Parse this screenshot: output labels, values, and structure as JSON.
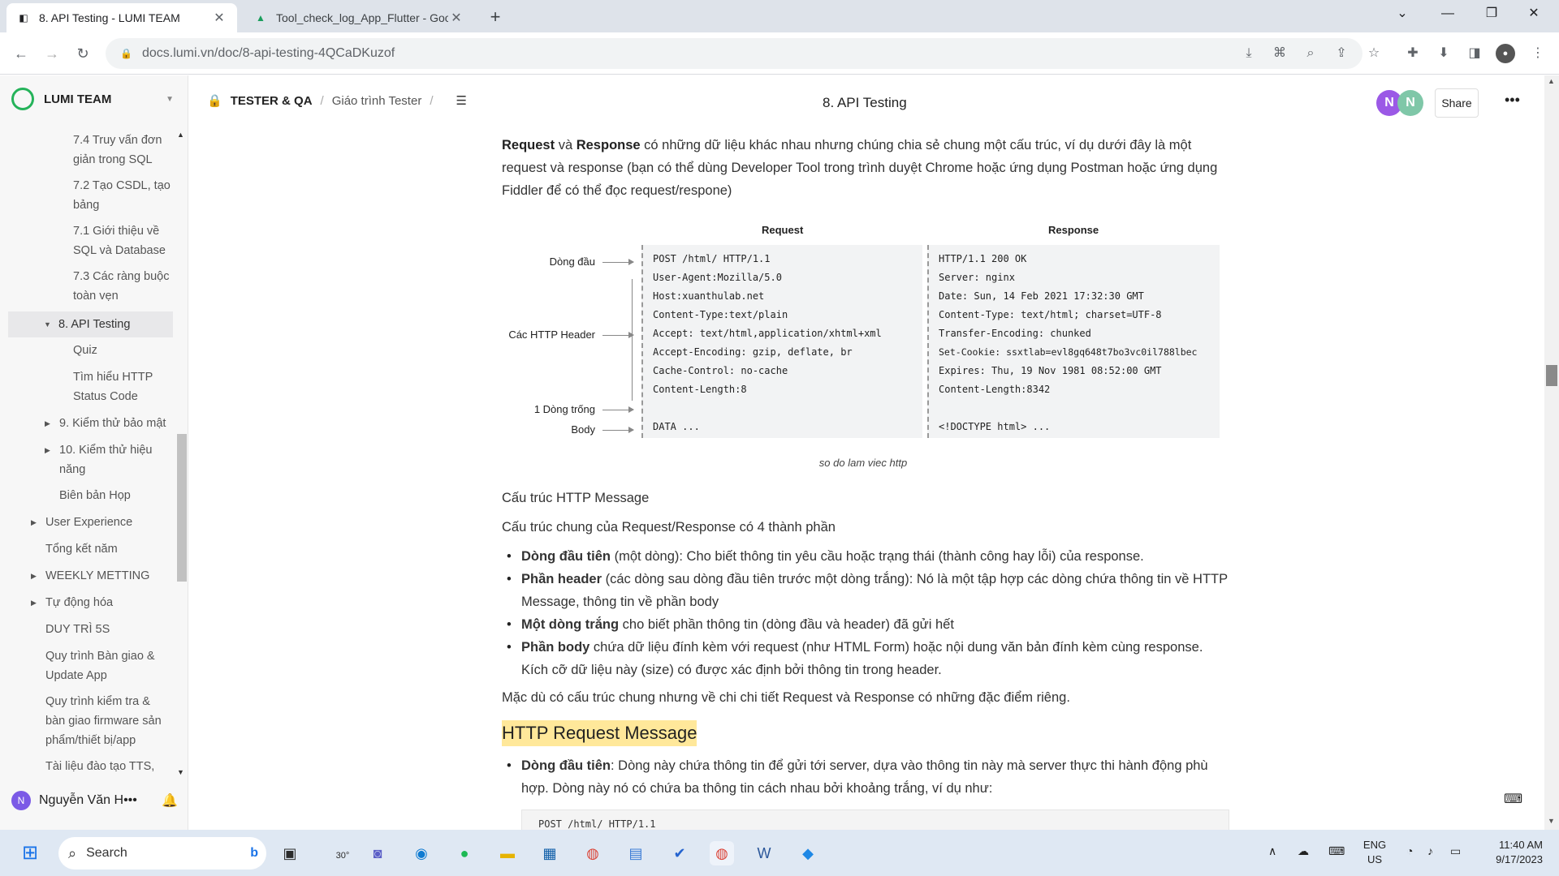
{
  "browser": {
    "tabs": [
      {
        "title": "8. API Testing - LUMI TEAM",
        "active": true
      },
      {
        "title": "Tool_check_log_App_Flutter - Goo",
        "active": false
      }
    ],
    "new_tab": "+",
    "url": "docs.lumi.vn/doc/8-api-testing-4QCaDKuzof"
  },
  "sidebar": {
    "team_name": "LUMI TEAM",
    "items": [
      {
        "label": "7.4 Truy vấn đơn",
        "label2": "giản trong SQL"
      },
      {
        "label": "7.2 Tạo CSDL, tạo",
        "label2": "bảng"
      },
      {
        "label": "7.1 Giới thiệu về",
        "label2": "SQL và Database"
      },
      {
        "label": "7.3 Các ràng buộc",
        "label2": "toàn vẹn"
      },
      {
        "label": "8. API Testing"
      },
      {
        "label": "Quiz"
      },
      {
        "label": "Tìm hiểu HTTP",
        "label2": "Status Code"
      },
      {
        "label": "9. Kiểm thử bảo mật"
      },
      {
        "label": "10. Kiểm thử hiệu",
        "label2": "năng"
      },
      {
        "label": "Biên bản Họp"
      },
      {
        "label": "User Experience"
      },
      {
        "label": "Tổng kết năm"
      },
      {
        "label": "WEEKLY METTING"
      },
      {
        "label": "Tự động hóa"
      },
      {
        "label": "DUY TRÌ 5S"
      },
      {
        "label": "Quy trình Bàn giao &",
        "label2": "Update App"
      },
      {
        "label": "Quy trình kiểm tra &",
        "label2": "bàn giao firmware sản",
        "label3": "phẩm/thiết bị/app"
      },
      {
        "label": "Tài liệu đào tạo TTS,"
      }
    ],
    "user_name": "Nguyễn Văn H•••",
    "user_initial": "N"
  },
  "header": {
    "breadcrumb": [
      "TESTER & QA",
      "Giáo trình Tester"
    ],
    "title": "8. API Testing",
    "avatars": [
      "N",
      "N"
    ],
    "share_label": "Share"
  },
  "content": {
    "intro_bold1": "Request",
    "intro_and": " và ",
    "intro_bold2": "Response",
    "intro_rest": " có những dữ liệu khác nhau nhưng chúng chia sẻ chung một cấu trúc, ví dụ dưới đây là một request và response (bạn có thể dùng Developer Tool trong trình duyệt Chrome hoặc ứng dụng Postman hoặc ứng dụng Fiddler để có thể đọc request/respone)",
    "figure": {
      "request_header": "Request",
      "response_header": "Response",
      "labels": [
        "Dòng đầu",
        "Các HTTP Header",
        "1 Dòng trống",
        "Body"
      ],
      "request_lines": [
        "POST /html/ HTTP/1.1",
        "User-Agent:Mozilla/5.0",
        "Host:xuanthulab.net",
        "Content-Type:text/plain",
        "Accept: text/html,application/xhtml+xml",
        "Accept-Encoding: gzip, deflate, br",
        "Cache-Control: no-cache",
        "Content-Length:8",
        "DATA ..."
      ],
      "response_lines": [
        "HTTP/1.1 200 OK",
        "Server: nginx",
        "Date: Sun, 14 Feb 2021 17:32:30 GMT",
        "Content-Type: text/html; charset=UTF-8",
        "Transfer-Encoding: chunked",
        "Set-Cookie: ssxtlab=evl8gq648t7bo3vc0il788lbec",
        "Expires: Thu, 19 Nov 1981 08:52:00 GMT",
        "Content-Length:8342",
        "<!DOCTYPE html> ..."
      ],
      "caption": "so do lam viec http"
    },
    "struct_title": "Cấu trúc HTTP Message",
    "struct_intro": "Cấu trúc chung của Request/Response có 4 thành phần",
    "bullets": [
      {
        "bold": "Dòng đầu tiên",
        "text": " (một dòng): Cho biết thông tin yêu cầu hoặc trạng thái (thành công hay lỗi) của response."
      },
      {
        "bold": "Phần header",
        "text": " (các dòng sau dòng đầu tiên trước một dòng trắng): Nó là một tập hợp các dòng chứa thông tin về HTTP Message, thông tin về phần body"
      },
      {
        "bold": "Một dòng trắng",
        "text": " cho biết phần thông tin (dòng đầu và header) đã gửi hết"
      },
      {
        "bold": "Phần body",
        "text": " chứa dữ liệu đính kèm với request (như HTML Form) hoặc nội dung văn bản đính kèm cùng response. Kích cỡ dữ liệu này (size) có được xác định bởi thông tin trong header."
      }
    ],
    "summary": "Mặc dù có cấu trúc chung nhưng về chi chi tiết Request và Response có những đặc điểm riêng.",
    "h2": "HTTP Request Message",
    "req_bullet_bold": "Dòng đầu tiên",
    "req_bullet_text": ": Dòng này chứa thông tin để gửi tới server, dựa vào thông tin này mà server thực thi hành động phù hợp. Dòng này nó có chứa ba thông tin cách nhau bởi khoảng trắng, ví dụ như:",
    "code_line": "POST /html/ HTTP/1.1"
  },
  "taskbar": {
    "search_placeholder": "Search",
    "weather": "30°",
    "lang1": "ENG",
    "lang2": "US",
    "time": "11:40 AM",
    "date": "9/17/2023"
  },
  "colors": {
    "accent_green": "#25b35a",
    "highlight": "#ffe89a",
    "avatar1": "#9b59e6",
    "avatar2": "#7fc7a8"
  }
}
